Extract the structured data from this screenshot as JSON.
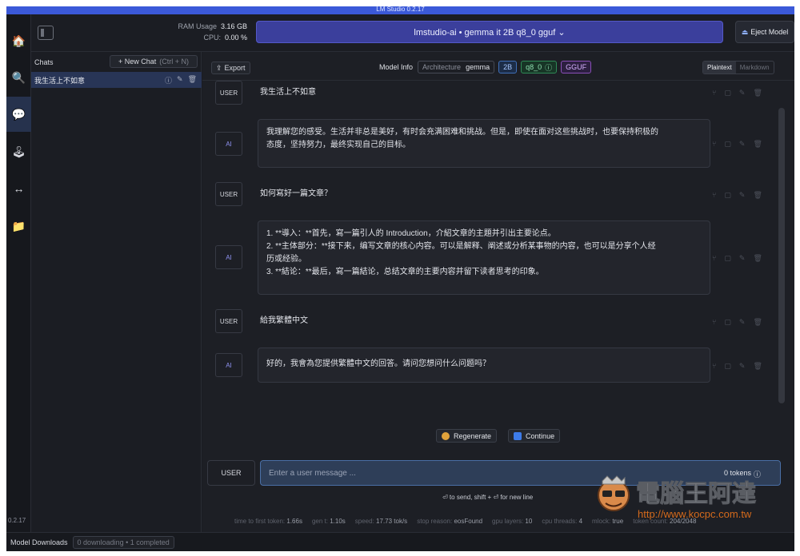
{
  "window": {
    "title": "LM Studio 0.2.17"
  },
  "rail": {
    "items": [
      {
        "icon": "home-icon",
        "glyph": "🏠"
      },
      {
        "icon": "search-icon",
        "glyph": "🔍"
      },
      {
        "icon": "chat-icon",
        "glyph": "💬"
      },
      {
        "icon": "local-server-icon",
        "glyph": "🕹"
      },
      {
        "icon": "arrows-icon",
        "glyph": "↔"
      },
      {
        "icon": "folder-icon",
        "glyph": "📁"
      }
    ],
    "version": "0.2.17"
  },
  "topbar": {
    "ram_label": "RAM Usage",
    "ram_value": "3.16 GB",
    "cpu_label": "CPU:",
    "cpu_value": "0.00 %",
    "model_selector": "lmstudio-ai • gemma it 2B q8_0 gguf ⌄",
    "eject_label": "Eject Model"
  },
  "sidebar": {
    "header": "Chats",
    "new_chat_label": "+ New Chat",
    "new_chat_shortcut": "(Ctrl + N)",
    "chats": [
      {
        "title": "我生活上不如意"
      }
    ]
  },
  "toolbar": {
    "export_label": "Export",
    "model_info_label": "Model Info",
    "architecture_label": "Architecture",
    "architecture_value": "gemma",
    "size_badge": "2B",
    "quant_badge": "q8_0",
    "format_badge": "GGUF",
    "view_plaintext": "Plaintext",
    "view_markdown": "Markdown"
  },
  "messages": [
    {
      "role": "USER",
      "lines": [
        "我生活上不如意"
      ]
    },
    {
      "role": "AI",
      "lines": [
        "我理解您的感受。生活并非总是美好，有时会充满困难和挑战。但是，即使在面对这些挑战时，也要保持积极的",
        "态度，坚持努力，最终实现自己的目标。"
      ]
    },
    {
      "role": "USER",
      "lines": [
        "如何寫好一篇文章？"
      ]
    },
    {
      "role": "AI",
      "lines": [
        "1. **導入：**首先，寫一篇引人的 Introduction，介紹文章的主題并引出主要论点。",
        "2. **主体部分：**接下来，编写文章的核心内容。可以是解释、阐述或分析某事物的内容，也可以是分享个人经",
        "历或经验。",
        "3. **結论：**最后，寫一篇結论，总结文章的主要内容并留下读者思考的印象。"
      ]
    },
    {
      "role": "USER",
      "lines": [
        "給我繁體中文"
      ]
    },
    {
      "role": "AI",
      "lines": [
        "好的，我會為您提供繁體中文的回答。请问您想问什么问题吗？"
      ]
    }
  ],
  "actions": {
    "regenerate_label": "Regenerate",
    "continue_label": "Continue"
  },
  "composer": {
    "role": "USER",
    "placeholder": "Enter a user message ...",
    "value": "",
    "token_count": "0 tokens",
    "hint": "⏎ to send, shift + ⏎ for new line"
  },
  "stats": [
    {
      "label": "time to first token:",
      "value": "1.66s"
    },
    {
      "label": "gen t:",
      "value": "1.10s"
    },
    {
      "label": "speed:",
      "value": "17.73 tok/s"
    },
    {
      "label": "stop reason:",
      "value": "eosFound"
    },
    {
      "label": "gpu layers:",
      "value": "10"
    },
    {
      "label": "cpu threads:",
      "value": "4"
    },
    {
      "label": "mlock:",
      "value": "true"
    },
    {
      "label": "token count:",
      "value": "204/2048"
    }
  ],
  "bottombar": {
    "downloads_label": "Model Downloads",
    "downloads_status": "0 downloading • 1 completed"
  },
  "watermark": {
    "text": "電腦王阿達",
    "url": "http://www.kocpc.com.tw"
  },
  "colors": {
    "accent": "#3b59d8",
    "model_selector": "#3b3f9c",
    "ai_role": "#8f92f0"
  }
}
